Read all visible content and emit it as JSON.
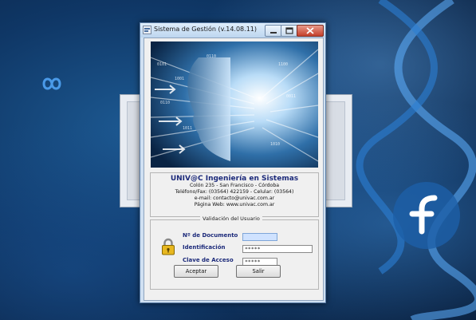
{
  "window": {
    "title": "Sistema de Gestión (v.14.08.11)"
  },
  "company": {
    "name": "UNIV@C Ingeniería en Sistemas",
    "address": "Colón 235 - San Francisco - Córdoba",
    "phone": "Teléfono/Fax: (03564) 422159 - Celular: (03564)",
    "email": "e-mail: contacto@univac.com.ar",
    "web": "Página Web: www.univac.com.ar"
  },
  "validation": {
    "legend": "Validación del Usuario",
    "documento_label": "Nº de Documento",
    "documento_value": "",
    "identificacion_label": "Identificación",
    "identificacion_value": "*****",
    "clave_label": "Clave de Acceso",
    "clave_value": "*****"
  },
  "buttons": {
    "accept": "Aceptar",
    "exit": "Salir"
  },
  "icons": {
    "app": "app-icon",
    "lock": "lock-icon",
    "minimize": "minimize-icon",
    "maximize": "maximize-icon",
    "close": "close-icon"
  },
  "colors": {
    "label": "#1c2a7a",
    "focused_field": "#cfe2ff",
    "close_button": "#c4402b"
  }
}
